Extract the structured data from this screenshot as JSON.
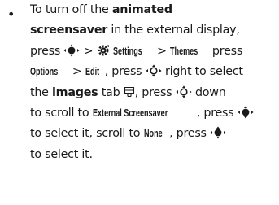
{
  "bullet": "•",
  "text": {
    "l1a": "To turn off the ",
    "l1b": "animated",
    "l2a": "screensaver",
    "l2b": " in the external display,",
    "l3a": "press ",
    "l3b": " > ",
    "l3c": " ",
    "l3d": "Settings",
    "l3e": " > ",
    "l3f": "Themes",
    "l3g": " press",
    "l4a": "Options",
    "l4b": " > ",
    "l4c": "Edit",
    "l4d": ", press ",
    "l4e": " right to select",
    "l5a": "the ",
    "l5b": "images",
    "l5c": " tab ",
    "l5d": ", press ",
    "l5e": " down",
    "l6a": "to scroll to ",
    "l6b": "External Screensaver",
    "l6c": ", press ",
    "l7a": "to select it, scroll to ",
    "l7b": "None",
    "l7c": ", press ",
    "l8a": "to select it."
  },
  "icons": {
    "center_key": "nav-center-key-icon",
    "nav_key": "nav-4way-key-icon",
    "settings": "settings-gear-icon",
    "tab": "tab-icon"
  }
}
